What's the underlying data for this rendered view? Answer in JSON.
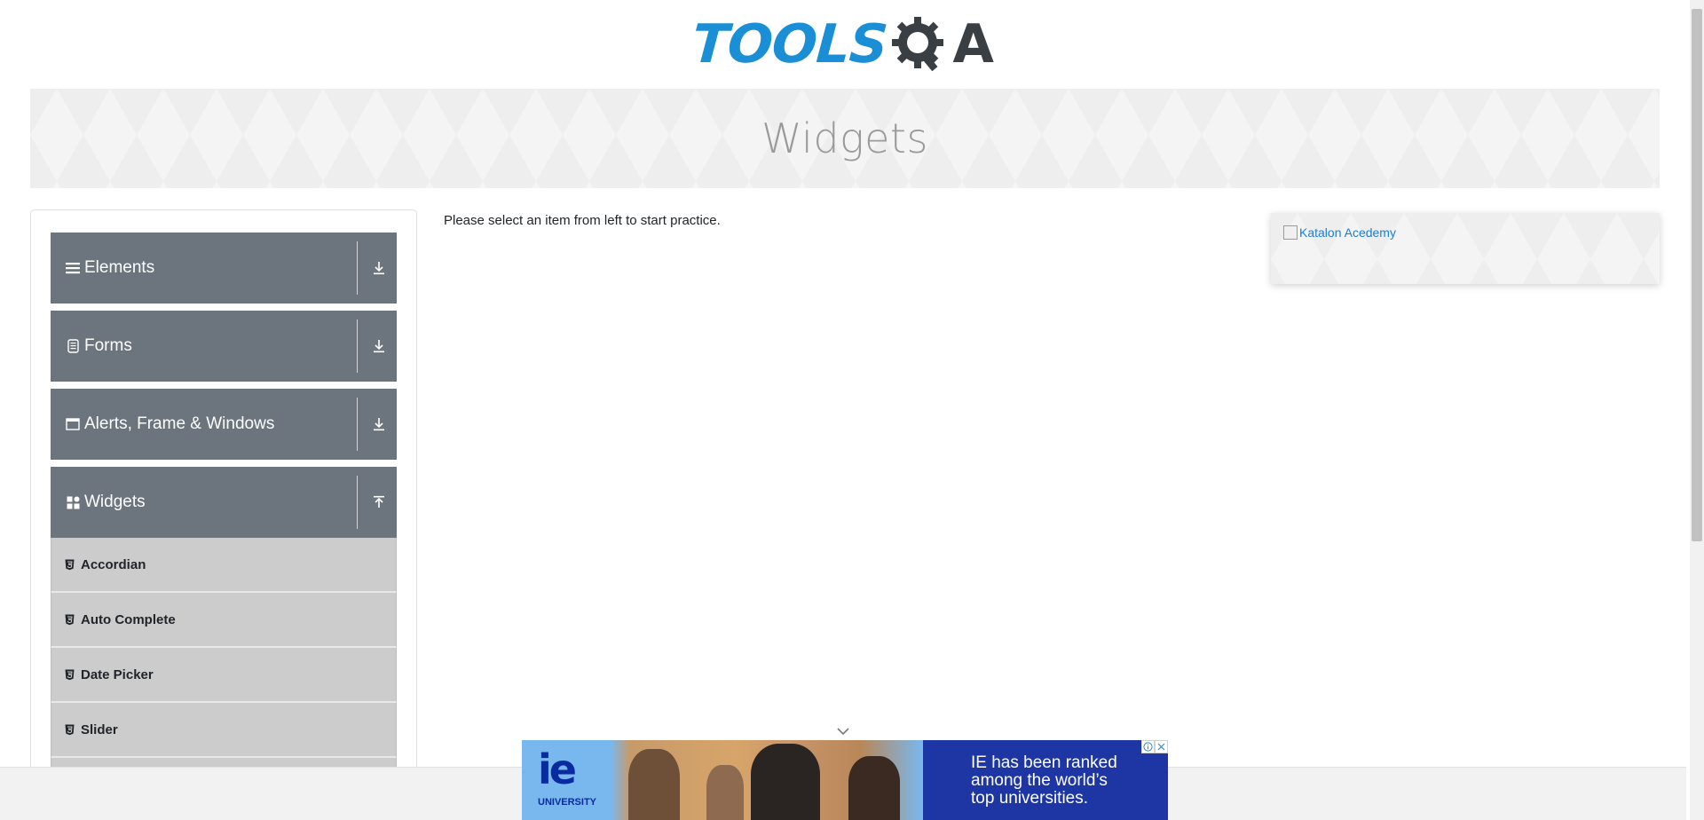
{
  "header": {
    "logo_part1": "TOOLS",
    "logo_part2": "A"
  },
  "banner": {
    "title": "Widgets"
  },
  "sidebar": {
    "groups": [
      {
        "label": "Elements",
        "icon": "hamburger-icon",
        "toggle": "download-icon"
      },
      {
        "label": "Forms",
        "icon": "document-icon",
        "toggle": "download-icon"
      },
      {
        "label": "Alerts, Frame & Windows",
        "icon": "window-icon",
        "toggle": "download-icon"
      },
      {
        "label": "Widgets",
        "icon": "grid-icon",
        "toggle": "upload-icon"
      }
    ],
    "widgets_items": [
      {
        "label": "Accordian",
        "icon": "html5-icon"
      },
      {
        "label": "Auto Complete",
        "icon": "html5-icon"
      },
      {
        "label": "Date Picker",
        "icon": "html5-icon"
      },
      {
        "label": "Slider",
        "icon": "html5-icon"
      }
    ]
  },
  "main": {
    "instruction": "Please select an item from left to start practice."
  },
  "right_ad": {
    "link_text": "Katalon Acedemy"
  },
  "ad_banner": {
    "brand": "ie",
    "sub": "UNIVERSITY",
    "line1": "IE has been ranked",
    "line2": "among the world’s",
    "line3": "top universities."
  },
  "colors": {
    "sidebar_header": "#6c757d",
    "sub_item": "#cccccc",
    "logo_blue": "#1b8fd6",
    "ad_background": "#1d36a4"
  }
}
